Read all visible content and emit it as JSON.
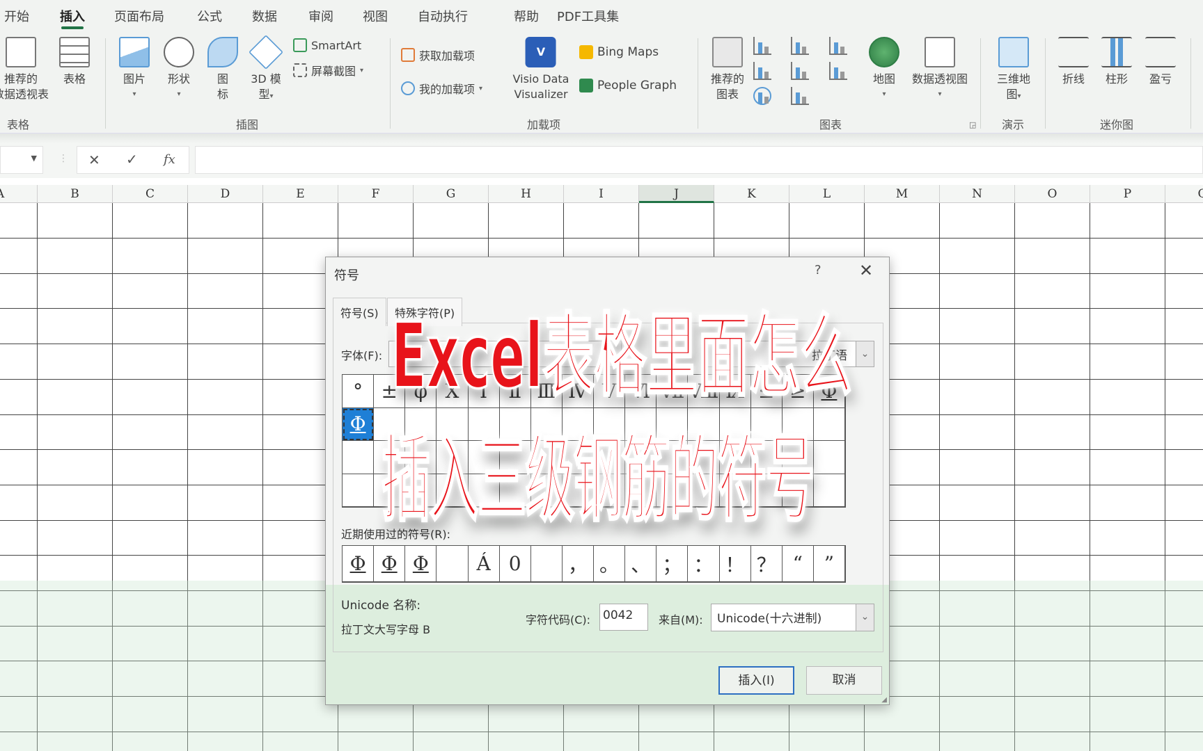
{
  "ribbon_tabs": [
    "开始",
    "插入",
    "页面布局",
    "公式",
    "数据",
    "审阅",
    "视图",
    "自动执行",
    "帮助",
    "PDF工具集"
  ],
  "active_tab": "插入",
  "ribbon": {
    "groups": {
      "tables": "表格",
      "illustrations": "插图",
      "addins": "加载项",
      "charts": "图表",
      "tours": "演示",
      "sparklines": "迷你图"
    },
    "pivot_l1": "推荐的",
    "pivot_l2": "数据透视表",
    "table": "表格",
    "pictures": "图片",
    "shapes": "形状",
    "icons_l1": "图",
    "icons_l2": "标",
    "model_l1": "3D 模",
    "model_l2": "型",
    "smartart": "SmartArt",
    "screenshot": "屏幕截图",
    "get_addins": "获取加载项",
    "my_addins": "我的加载项",
    "visio_l1": "Visio Data",
    "visio_l2": "Visualizer",
    "bing_maps": "Bing Maps",
    "people_graph": "People Graph",
    "rec_charts_l1": "推荐的",
    "rec_charts_l2": "图表",
    "maps": "地图",
    "pivot_chart": "数据透视图",
    "map3d_l1": "三维地",
    "map3d_l2": "图",
    "line": "折线",
    "column": "柱形",
    "winloss": "盈亏"
  },
  "formula_bar": {
    "cancel": "✕",
    "enter": "✓",
    "fx": "fx",
    "value": ""
  },
  "columns": [
    "A",
    "B",
    "C",
    "D",
    "E",
    "F",
    "G",
    "H",
    "I",
    "J",
    "K",
    "L",
    "M",
    "N",
    "O",
    "P",
    "Q"
  ],
  "selected_column": "J",
  "dialog": {
    "title": "符号",
    "help": "?",
    "close": "✕",
    "tab_symbols": "符号(S)",
    "tab_special": "特殊字符(P)",
    "font_label": "字体(F):",
    "font_value": "SJQY",
    "subset_value": "拉丁语",
    "symbols": [
      "°",
      "±",
      "φ",
      "Ⅹ",
      "Ⅰ",
      "Ⅱ",
      "Ⅲ",
      "Ⅳ",
      "Ⅴ",
      "Ⅵ",
      "Ⅶ",
      "Ⅷ",
      "Ⅸ",
      "≤",
      "≥",
      "Φ",
      "Φ",
      "",
      "",
      "",
      "",
      "",
      "",
      "",
      "",
      "",
      "",
      "",
      "",
      "",
      "",
      "",
      "",
      "",
      "",
      "",
      "",
      "",
      "",
      "",
      "",
      "",
      "",
      "",
      "",
      "",
      "",
      "",
      "",
      "",
      "",
      "",
      "",
      "",
      "",
      "",
      "",
      "",
      "",
      "",
      "",
      "",
      "",
      "",
      ""
    ],
    "selected_symbol_index": 16,
    "recent_label": "近期使用过的符号(R):",
    "recent": [
      "Φ",
      "Φ",
      "Φ",
      "",
      "Á",
      "0",
      "",
      "，",
      "。",
      "、",
      "；",
      "：",
      "！",
      "？",
      "“",
      "”"
    ],
    "unicode_name_label": "Unicode 名称:",
    "unicode_name": "拉丁文大写字母 B",
    "char_code_label": "字符代码(C):",
    "char_code": "0042",
    "from_label": "来自(M):",
    "from_value": "Unicode(十六进制)",
    "insert": "插入(I)",
    "cancel": "取消"
  },
  "overlay": {
    "line1": "Excel表格里面怎么",
    "line2": "插入三级钢筋的符号",
    "color": "#e8131a"
  }
}
